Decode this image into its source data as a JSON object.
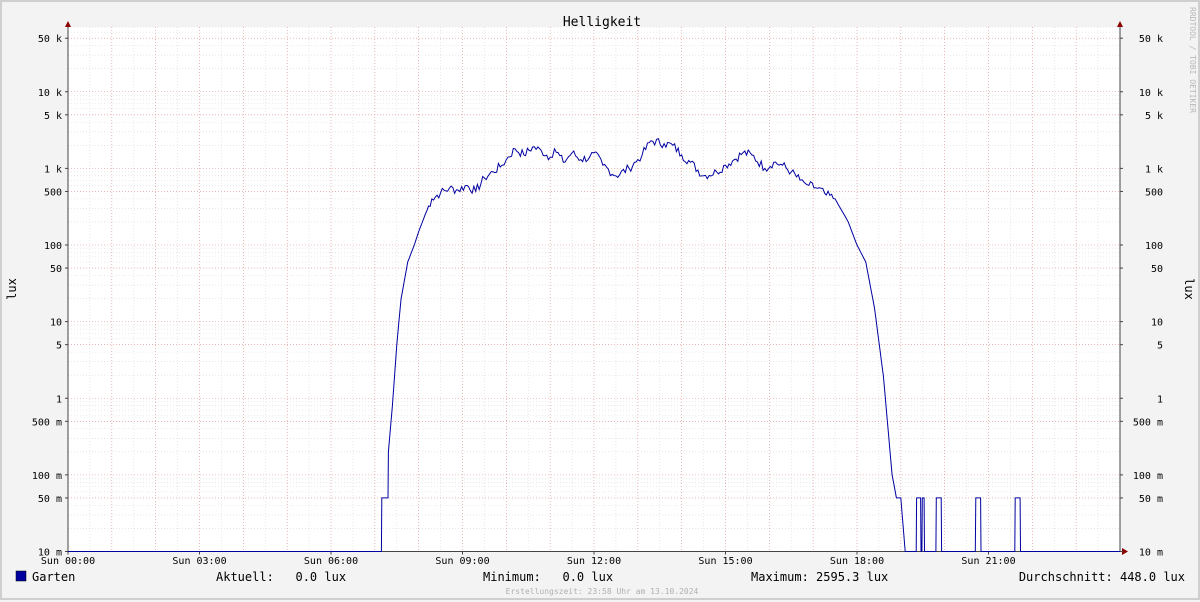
{
  "chart_data": {
    "type": "line",
    "title": "Helligkeit",
    "ylabel": "lux",
    "ylabel_right": "lux",
    "watermark": "RRDTOOL / TOBI OETIKER",
    "y_scale": "log",
    "ylim": [
      0.01,
      70000
    ],
    "xlim_hours": [
      0,
      24
    ],
    "x_tick_labels": [
      {
        "h": 0,
        "label": "Sun 00:00"
      },
      {
        "h": 3,
        "label": "Sun 03:00"
      },
      {
        "h": 6,
        "label": "Sun 06:00"
      },
      {
        "h": 9,
        "label": "Sun 09:00"
      },
      {
        "h": 12,
        "label": "Sun 12:00"
      },
      {
        "h": 15,
        "label": "Sun 15:00"
      },
      {
        "h": 18,
        "label": "Sun 18:00"
      },
      {
        "h": 21,
        "label": "Sun 21:00"
      }
    ],
    "y_tick_labels": [
      {
        "v": 50000,
        "label": "50 k"
      },
      {
        "v": 10000,
        "label": "10 k"
      },
      {
        "v": 5000,
        "label": "5 k"
      },
      {
        "v": 1000,
        "label": "1 k"
      },
      {
        "v": 500,
        "label": "500"
      },
      {
        "v": 100,
        "label": "100"
      },
      {
        "v": 50,
        "label": "50"
      },
      {
        "v": 10,
        "label": "10"
      },
      {
        "v": 5,
        "label": "5"
      },
      {
        "v": 1,
        "label": "1"
      },
      {
        "v": 0.5,
        "label": "500 m"
      },
      {
        "v": 0.1,
        "label": "100 m"
      },
      {
        "v": 0.05,
        "label": "50 m"
      },
      {
        "v": 0.01,
        "label": "10 m"
      }
    ],
    "grid": true,
    "series": [
      {
        "name": "Garten",
        "color": "#0000a0",
        "x_hours": [
          0.0,
          7.15,
          7.16,
          7.3,
          7.31,
          7.4,
          7.5,
          7.6,
          7.75,
          7.9,
          8.0,
          8.15,
          8.3,
          8.5,
          8.7,
          8.9,
          9.1,
          9.3,
          9.5,
          9.7,
          9.9,
          10.0,
          10.2,
          10.4,
          10.6,
          10.8,
          11.0,
          11.1,
          11.3,
          11.5,
          11.7,
          11.9,
          12.0,
          12.2,
          12.5,
          12.8,
          13.0,
          13.1,
          13.3,
          13.6,
          13.8,
          14.0,
          14.2,
          14.5,
          14.8,
          15.0,
          15.2,
          15.4,
          15.6,
          15.9,
          16.1,
          16.3,
          16.5,
          16.7,
          16.8,
          16.9,
          17.1,
          17.3,
          17.5,
          17.8,
          18.0,
          18.2,
          18.4,
          18.6,
          18.8,
          18.9,
          19.0,
          19.1,
          19.2,
          19.3,
          19.35,
          19.36,
          19.45,
          19.46,
          19.48,
          19.49,
          19.53,
          19.54,
          19.8,
          19.81,
          19.92,
          19.93,
          20.7,
          20.71,
          20.82,
          20.83,
          21.6,
          21.61,
          21.72,
          21.73,
          24.0
        ],
        "values": [
          0.01,
          0.01,
          0.05,
          0.05,
          0.2,
          0.8,
          5,
          20,
          60,
          100,
          150,
          250,
          400,
          480,
          550,
          520,
          600,
          500,
          750,
          900,
          1100,
          1300,
          1800,
          1500,
          1900,
          1700,
          1400,
          1800,
          1200,
          1600,
          1300,
          1400,
          1600,
          1100,
          800,
          1000,
          1300,
          1500,
          2300,
          2100,
          2000,
          1500,
          1200,
          800,
          900,
          1100,
          1300,
          1600,
          1500,
          1000,
          1200,
          1100,
          900,
          700,
          650,
          600,
          550,
          450,
          400,
          200,
          100,
          60,
          15,
          2,
          0.1,
          0.05,
          0.05,
          0.01,
          0.01,
          0.01,
          0.01,
          0.05,
          0.05,
          0.01,
          0.01,
          0.05,
          0.05,
          0.01,
          0.01,
          0.05,
          0.05,
          0.01,
          0.01,
          0.05,
          0.05,
          0.01,
          0.01,
          0.05,
          0.05,
          0.01,
          0.01
        ]
      }
    ]
  },
  "legend": {
    "series_name": "Garten",
    "aktuell": "Aktuell:   0.0 lux",
    "minimum": "Minimum:   0.0 lux",
    "maximum": "Maximum: 2595.3 lux",
    "durchschnitt": "Durchschnitt: 448.0 lux",
    "footer": "Erstellungszeit: 23:58 Uhr am 13.10.2024"
  },
  "colors": {
    "series": "#0000a0",
    "minor_grid": "#d8d8d8",
    "major_grid": "#e08b8b",
    "axis": "#444444",
    "arrow": "#8b0000"
  }
}
